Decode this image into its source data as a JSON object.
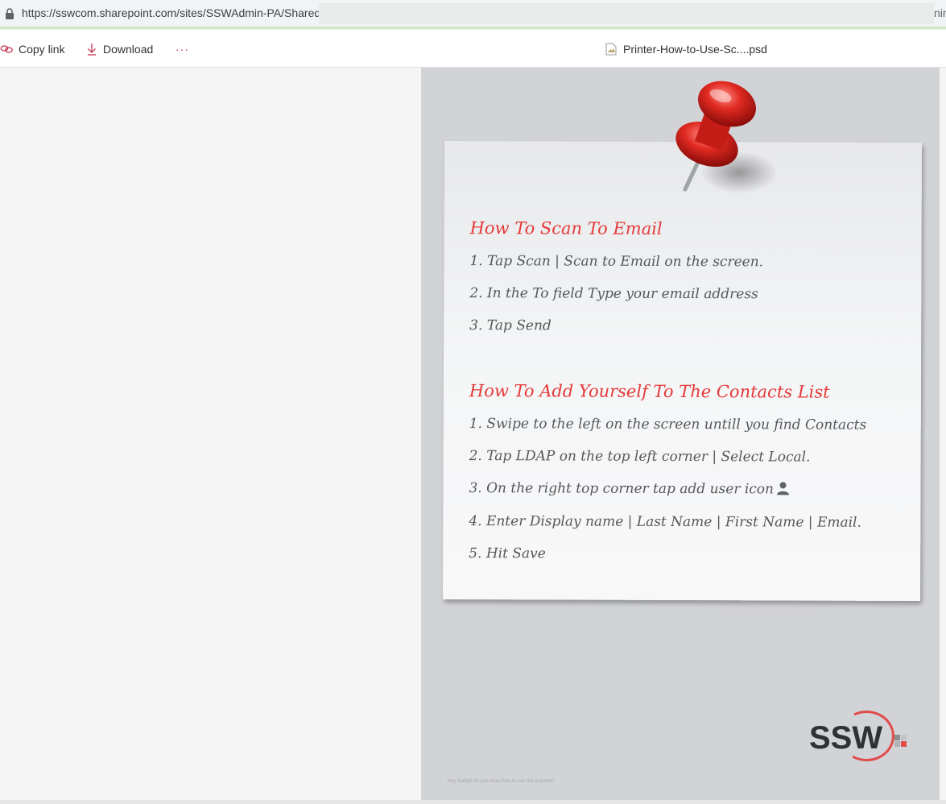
{
  "address_bar": {
    "url_visible": "https://sswcom.sharepoint.com/sites/SSWAdmin-PA/Shared",
    "url_tail": "nin"
  },
  "toolbar": {
    "copy_link_label": "Copy link",
    "download_label": "Download",
    "more_label": "···",
    "file_name": "Printer-How-to-Use-Sc....psd"
  },
  "document": {
    "scan_title": "How To Scan To Email",
    "scan_steps": [
      "1. Tap Scan | Scan to Email on the screen.",
      "2. In the To field Type your email address",
      "3. Tap Send"
    ],
    "contacts_title": "How To Add Yourself To The Contacts List",
    "contacts_steps": [
      "1. Swipe to the left on the screen untill you find Contacts",
      "2. Tap LDAP on the top left corner | Select Local.",
      "3. On the right top corner tap add user icon",
      "4. Enter Display name | Last Name | First Name | Email.",
      "5. Hit Save"
    ],
    "logo_text": "SSW",
    "footer_text": "Hey buddy! do you know how to use the scanner?"
  },
  "colors": {
    "title_red": "#e53a3a",
    "step_gray": "#555759",
    "preview_bg": "#d2d3d6",
    "accent_red": "#c4314b"
  }
}
